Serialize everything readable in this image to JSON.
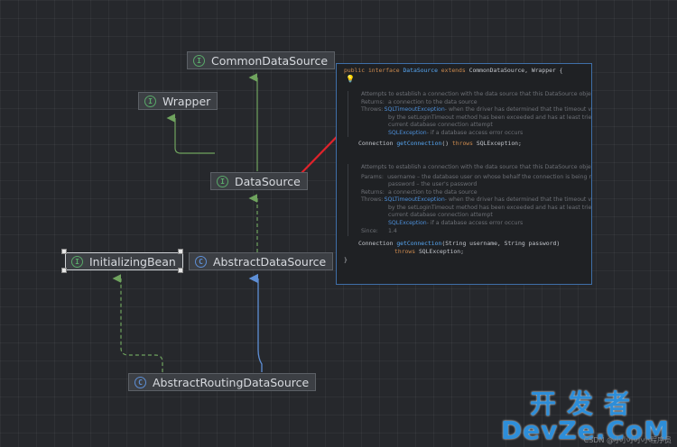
{
  "nodes": {
    "common_data_source": {
      "label": "CommonDataSource",
      "kind": "interface"
    },
    "wrapper": {
      "label": "Wrapper",
      "kind": "interface"
    },
    "data_source": {
      "label": "DataSource",
      "kind": "interface"
    },
    "initializing_bean": {
      "label": "InitializingBean",
      "kind": "interface"
    },
    "abstract_data_source": {
      "label": "AbstractDataSource",
      "kind": "abstract-class"
    },
    "abstract_routing_data_source": {
      "label": "AbstractRoutingDataSource",
      "kind": "abstract-class"
    }
  },
  "icons": {
    "interface_glyph": "I",
    "abstract_glyph": "C"
  },
  "colors": {
    "interface_icon": "#59a869",
    "abstract_icon": "#5e8fd6",
    "extends_edge": "#6fa35e",
    "implements_edge": "#6fa35e",
    "class_extends_edge": "#5e8fd6",
    "pointer_arrow": "#e0232b",
    "popup_border": "#3f6fa8"
  },
  "popup": {
    "decl": {
      "kw1": "public",
      "kw2": "interface",
      "name": "DataSource",
      "kw3": "extends",
      "rest": "CommonDataSource, Wrapper {"
    },
    "doc1": {
      "summary": "Attempts to establish a connection with the data source that this DataSource objec",
      "returns_tag": "Returns:",
      "returns": "a connection to the data source",
      "throws_tag": "Throws:",
      "throws_link1": "SQLTimeoutException",
      "throws_text1": " - when the driver has determined that the timeout v",
      "throws_text2": "by the setLoginTimeout method has been exceeded and has at least tried",
      "throws_text3": "current database connection attempt",
      "throws_link2": "SQLException",
      "throws_text4": " - if a database access error occurs"
    },
    "sig1": {
      "type": "Connection ",
      "method": "getConnection",
      "args": "() ",
      "kw": "throws",
      "exc": " SQLException;"
    },
    "doc2": {
      "summary": "Attempts to establish a connection with the data source that this DataSource objec",
      "params_tag": "Params:",
      "param1": "username – the database user on whose behalf the connection is being r",
      "param2": "password – the user's password",
      "returns_tag": "Returns:",
      "returns": "a connection to the data source",
      "throws_tag": "Throws:",
      "throws_link1": "SQLTimeoutException",
      "throws_text1": " - when the driver has determined that the timeout v",
      "throws_text2": "by the setLoginTimeout method has been exceeded and has at least tried",
      "throws_text3": "current database connection attempt",
      "throws_link2": "SQLException",
      "throws_text4": " - if a database access error occurs",
      "since_tag": "Since:",
      "since": "1.4"
    },
    "sig2": {
      "type": "Connection ",
      "method": "getConnection",
      "args": "(String username, String password)",
      "kw": "throws",
      "exc": " SQLException;"
    },
    "close": "}"
  },
  "watermark": {
    "cn": "开发者",
    "en": "DevZe.CoM",
    "small": "CSDN @小小小小小程序员"
  }
}
